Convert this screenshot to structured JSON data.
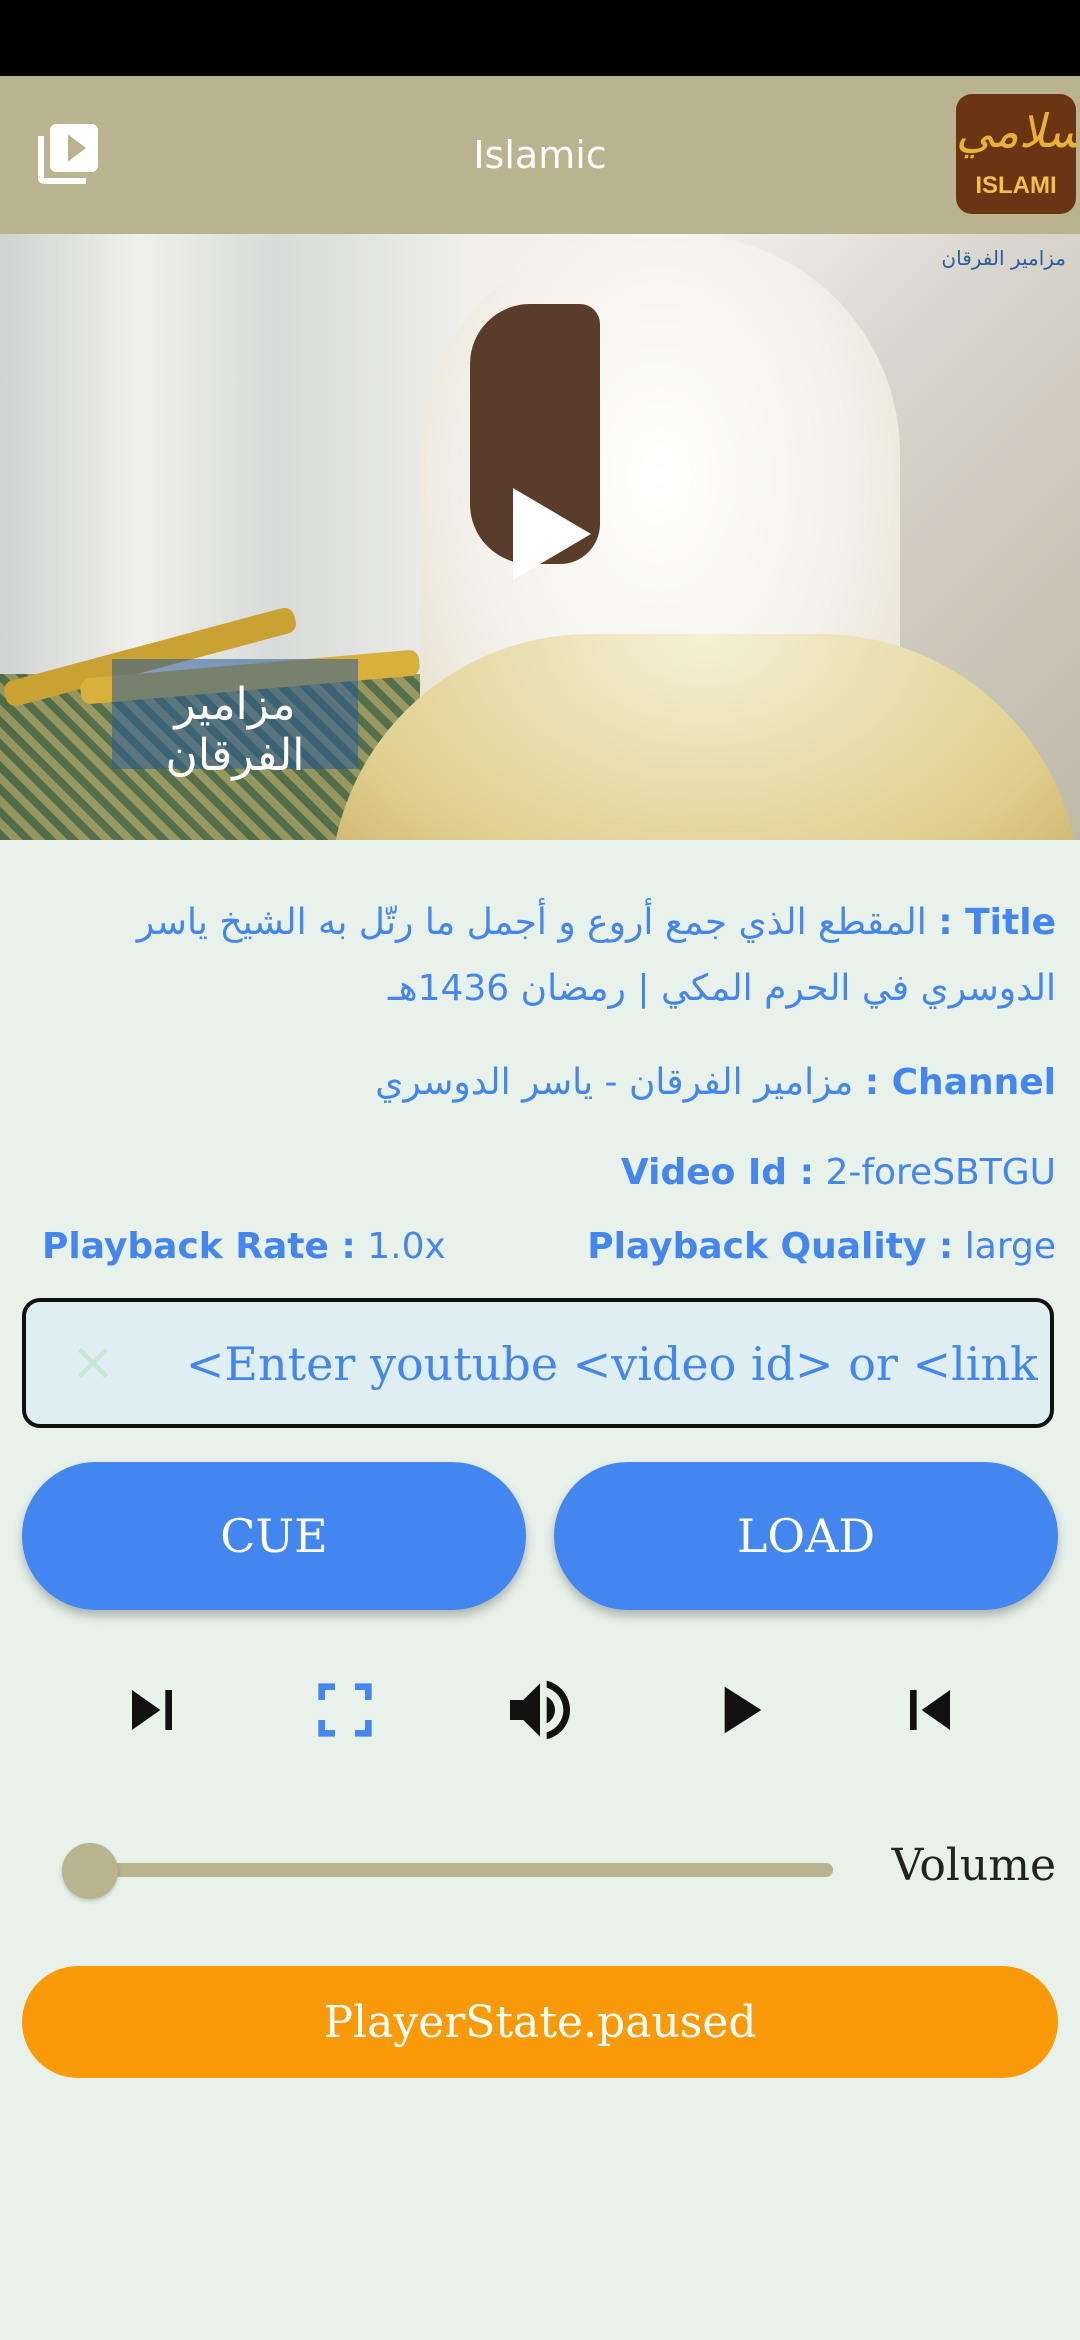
{
  "app_bar": {
    "title": "Islamic",
    "logo_text": "ISLAMI",
    "logo_script": "إسلامي"
  },
  "video": {
    "caption": "مزامير الفرقان",
    "watermark": "مزامير الفرقان"
  },
  "info": {
    "title_label": "Title :",
    "title_value": "المقطع الذي جمع أروع و أجمل ما رتّل به الشيخ ياسر الدوسري في الحرم المكي | رمضان 1436هـ",
    "channel_label": "Channel :",
    "channel_value": "مزامير الفرقان - ياسر الدوسري",
    "video_id_label": "Video Id :",
    "video_id_value": "2-foreSBTGU",
    "playback_rate_label": "Playback Rate :",
    "playback_rate_value": "1.0x",
    "playback_quality_label": "Playback Quality :",
    "playback_quality_value": "large"
  },
  "input": {
    "placeholder": "<Enter youtube <video id> or <link"
  },
  "buttons": {
    "cue": "CUE",
    "load": "LOAD"
  },
  "controls": [
    "skip-next-icon",
    "fullscreen-icon",
    "volume-icon",
    "play-icon",
    "skip-previous-icon"
  ],
  "volume": {
    "label": "Volume",
    "level": 0
  },
  "player_state": "PlayerState.paused",
  "colors": {
    "app_bar": "#b9b38f",
    "accent": "#4486f0",
    "state": "#fb9a08",
    "background": "#e8f1ea"
  }
}
